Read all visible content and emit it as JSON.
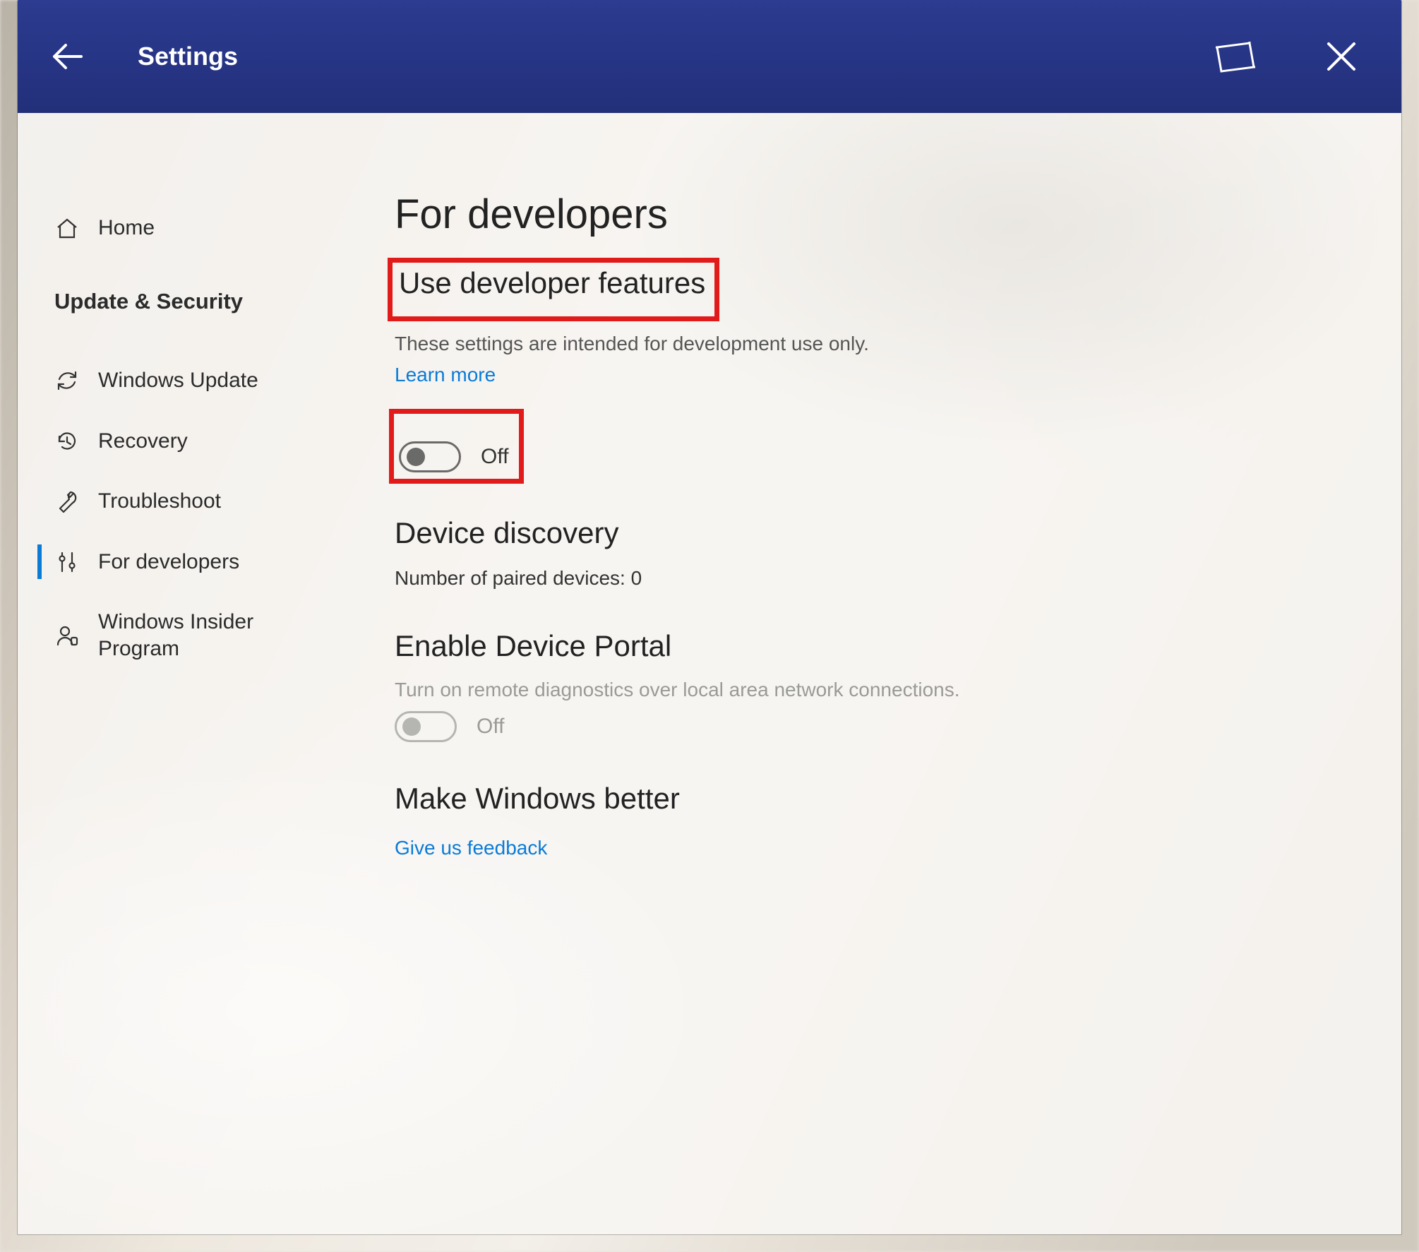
{
  "window": {
    "title": "Settings"
  },
  "sidebar": {
    "home": "Home",
    "section": "Update & Security",
    "items": [
      {
        "label": "Windows Update"
      },
      {
        "label": "Recovery"
      },
      {
        "label": "Troubleshoot"
      },
      {
        "label": "For developers"
      },
      {
        "label": "Windows Insider Program"
      }
    ]
  },
  "main": {
    "title": "For developers",
    "dev_features": {
      "heading": "Use developer features",
      "desc": "These settings are intended for development use only.",
      "learn_more": "Learn more",
      "toggle_state": "Off"
    },
    "device_discovery": {
      "heading": "Device discovery",
      "paired_label": "Number of paired devices: ",
      "paired_count": "0"
    },
    "device_portal": {
      "heading": "Enable Device Portal",
      "desc": "Turn on remote diagnostics over local area network connections.",
      "toggle_state": "Off"
    },
    "make_better": {
      "heading": "Make Windows better",
      "feedback_link": "Give us feedback"
    }
  },
  "colors": {
    "accent": "#0a7bd6",
    "highlight": "#e11a1a",
    "titlebar": "#273586"
  }
}
